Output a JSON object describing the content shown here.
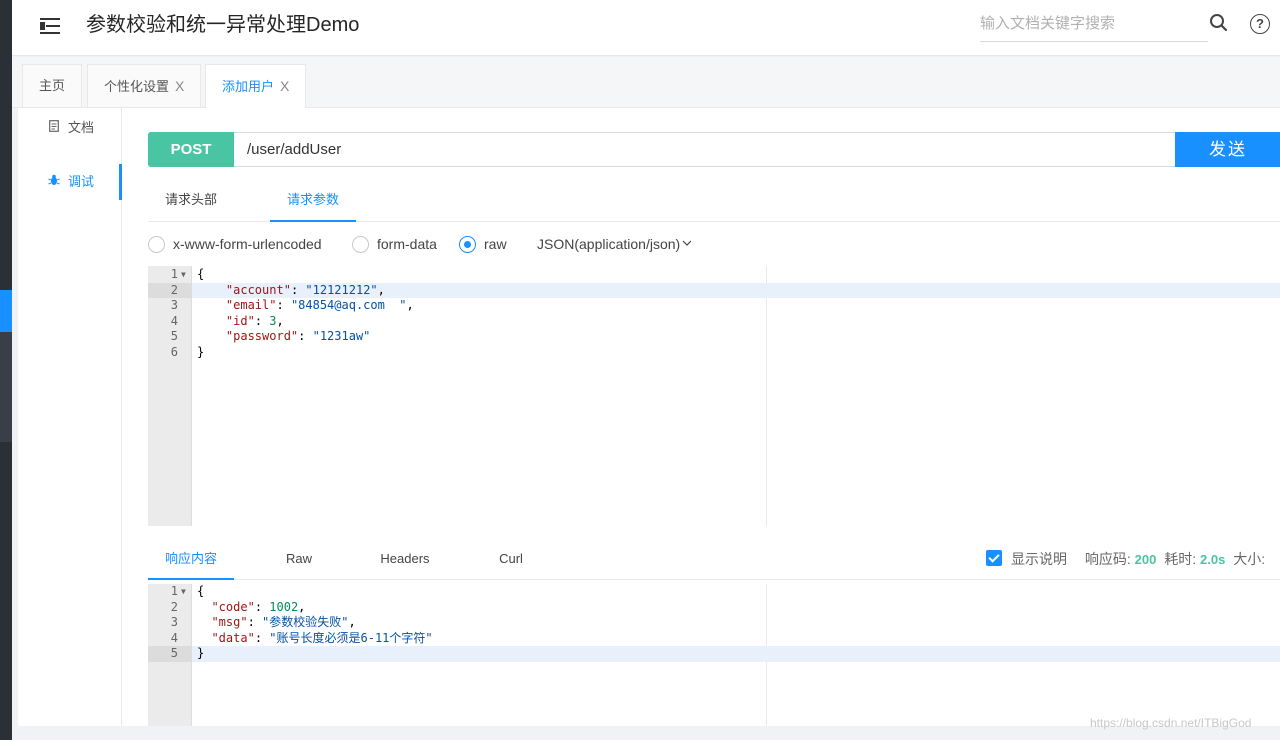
{
  "header": {
    "title": "参数校验和统一异常处理Demo",
    "search_placeholder": "输入文档关键字搜索",
    "help_symbol": "?"
  },
  "tabs": [
    {
      "label": "主页",
      "closable": false
    },
    {
      "label": "个性化设置",
      "closable": true
    },
    {
      "label": "添加用户",
      "closable": true,
      "active": true
    }
  ],
  "tab_close_symbol": "X",
  "side_menu": [
    {
      "label": "文档",
      "icon": "document-icon"
    },
    {
      "label": "调试",
      "icon": "bug-icon",
      "active": true
    }
  ],
  "request": {
    "method": "POST",
    "url": "/user/addUser",
    "send_label": "发送",
    "tabs": [
      "请求头部",
      "请求参数"
    ],
    "active_tab": "请求参数",
    "body_types": [
      "x-www-form-urlencoded",
      "form-data",
      "raw"
    ],
    "selected_body_type": "raw",
    "content_type": "JSON(application/json)",
    "body_lines": [
      "{",
      "    \"account\": \"12121212\",",
      "    \"email\": \"84854@aq.com  \",",
      "    \"id\": 3,",
      "    \"password\": \"1231aw\"",
      "}"
    ]
  },
  "response": {
    "tabs": [
      "响应内容",
      "Raw",
      "Headers",
      "Curl"
    ],
    "active_tab": "响应内容",
    "show_description_label": "显示说明",
    "show_description_checked": true,
    "status_label": "响应码:",
    "status_code": "200",
    "time_label": "耗时:",
    "time_value": "2.0s",
    "size_label": "大小:",
    "body_lines": [
      "{",
      "  \"code\": 1002,",
      "  \"msg\": \"参数校验失败\",",
      "  \"data\": \"账号长度必须是6-11个字符\"",
      "}"
    ]
  },
  "watermark": "https://blog.csdn.net/ITBigGod",
  "colors": {
    "accent": "#1890ff",
    "post_method": "#49c5a3",
    "dark_sidebar": "#2b2f36"
  }
}
